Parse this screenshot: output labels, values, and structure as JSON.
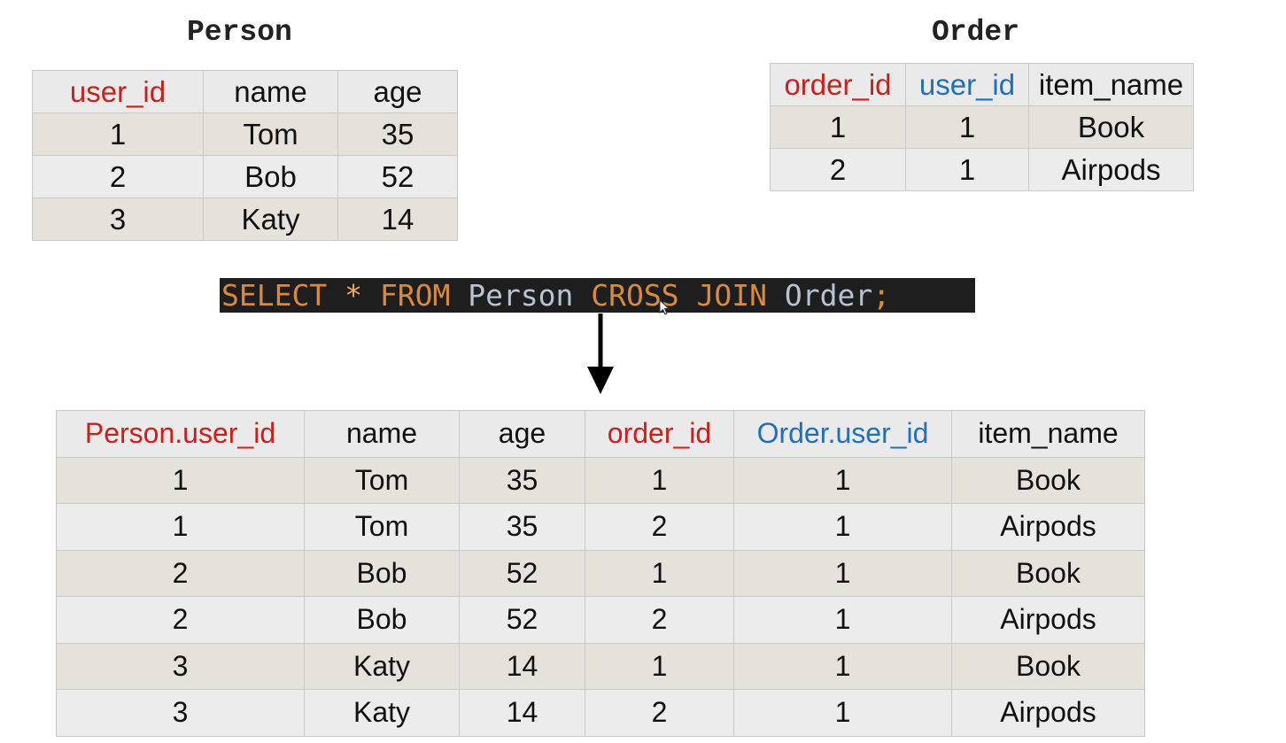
{
  "person": {
    "caption": "Person",
    "headers": [
      "user_id",
      "name",
      "age"
    ],
    "rows": [
      [
        "1",
        "Tom",
        "35"
      ],
      [
        "2",
        "Bob",
        "52"
      ],
      [
        "3",
        "Katy",
        "14"
      ]
    ]
  },
  "order": {
    "caption": "Order",
    "headers": [
      "order_id",
      "user_id",
      "item_name"
    ],
    "rows": [
      [
        "1",
        "1",
        "Book"
      ],
      [
        "2",
        "1",
        "Airpods"
      ]
    ]
  },
  "query": {
    "select": "SELECT",
    "star": "*",
    "from": "FROM",
    "table1": "Person",
    "cross_join": "CROSS JOIN",
    "table2": "Order",
    "semicolon": ";"
  },
  "result": {
    "headers": [
      "Person.user_id",
      "name",
      "age",
      "order_id",
      "Order.user_id",
      "item_name"
    ],
    "rows": [
      [
        "1",
        "Tom",
        "35",
        "1",
        "1",
        "Book"
      ],
      [
        "1",
        "Tom",
        "35",
        "2",
        "1",
        "Airpods"
      ],
      [
        "2",
        "Bob",
        "52",
        "1",
        "1",
        "Book"
      ],
      [
        "2",
        "Bob",
        "52",
        "2",
        "1",
        "Airpods"
      ],
      [
        "3",
        "Katy",
        "14",
        "1",
        "1",
        "Book"
      ],
      [
        "3",
        "Katy",
        "14",
        "2",
        "1",
        "Airpods"
      ]
    ]
  },
  "colors": {
    "key_red": "#cc1f1a",
    "key_blue": "#1f6fbf",
    "sql_keyword": "#d98a3a",
    "sql_identifier": "#b8c2d0",
    "sql_background": "#1e1e1e"
  }
}
